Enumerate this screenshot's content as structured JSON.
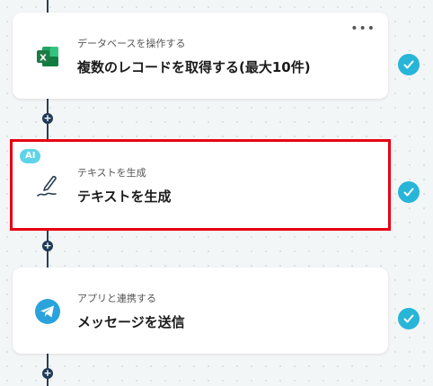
{
  "steps": [
    {
      "subtitle": "データベースを操作する",
      "title": "複数のレコードを取得する(最大10件)",
      "icon": "excel-icon",
      "menu_label": "•••",
      "completed": true
    },
    {
      "badge": "AI",
      "subtitle": "テキストを生成",
      "title": "テキストを生成",
      "icon": "pen-icon",
      "completed": true,
      "selected": true
    },
    {
      "subtitle": "アプリと連携する",
      "title": "メッセージを送信",
      "icon": "telegram-icon",
      "completed": true
    }
  ],
  "add_step_label": "+",
  "colors": {
    "connector": "#2a3e54",
    "check": "#27b5d8",
    "ai_badge": "#5fd3e9",
    "selection": "#e60012",
    "excel_green": "#1d7a45",
    "telegram_blue": "#2aa3dd"
  }
}
